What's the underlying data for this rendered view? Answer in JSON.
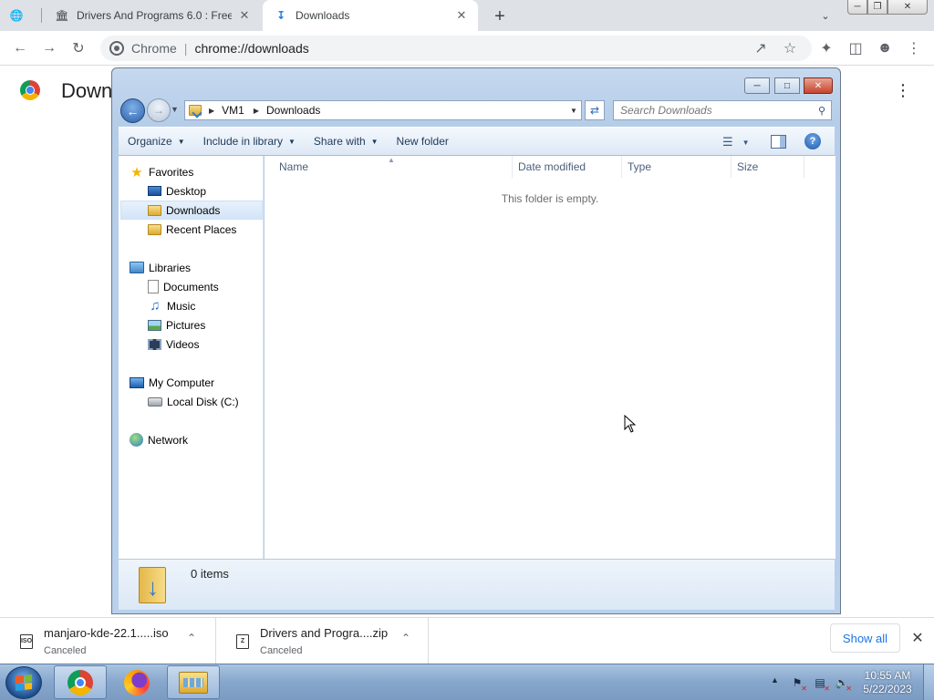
{
  "chrome": {
    "tabs": [
      {
        "title": "",
        "icon": "globe-icon"
      },
      {
        "title": "Drivers And Programs 6.0 : Free ",
        "icon": "archive-icon"
      },
      {
        "title": "Downloads",
        "icon": "download-icon",
        "active": true
      }
    ],
    "toolbar": {
      "site_name": "Chrome",
      "url": "chrome://downloads"
    },
    "page": {
      "title": "Down"
    }
  },
  "explorer": {
    "breadcrumb": [
      "VM1",
      "Downloads"
    ],
    "search_placeholder": "Search Downloads",
    "commands": {
      "organize": "Organize",
      "include": "Include in library",
      "share": "Share with",
      "new_folder": "New folder"
    },
    "nav": {
      "favorites": "Favorites",
      "desktop": "Desktop",
      "downloads": "Downloads",
      "recent": "Recent Places",
      "libraries": "Libraries",
      "documents": "Documents",
      "music": "Music",
      "pictures": "Pictures",
      "videos": "Videos",
      "computer": "My Computer",
      "local_disk": "Local Disk (C:)",
      "network": "Network"
    },
    "columns": [
      "Name",
      "Date modified",
      "Type",
      "Size"
    ],
    "empty_message": "This folder is empty.",
    "item_count": "0 items"
  },
  "downloads_shelf": {
    "items": [
      {
        "name": "manjaro-kde-22.1.....iso",
        "status": "Canceled",
        "icon_label": "ISO"
      },
      {
        "name": "Drivers and Progra....zip",
        "status": "Canceled",
        "icon_label": "Z"
      }
    ],
    "show_all": "Show all"
  },
  "taskbar": {
    "time": "10:55 AM",
    "date": "5/22/2023"
  },
  "colors": {
    "chrome_blue": "#1a73e8",
    "explorer_frame": "#b9d1ea",
    "taskbar": "#86a6cc"
  }
}
